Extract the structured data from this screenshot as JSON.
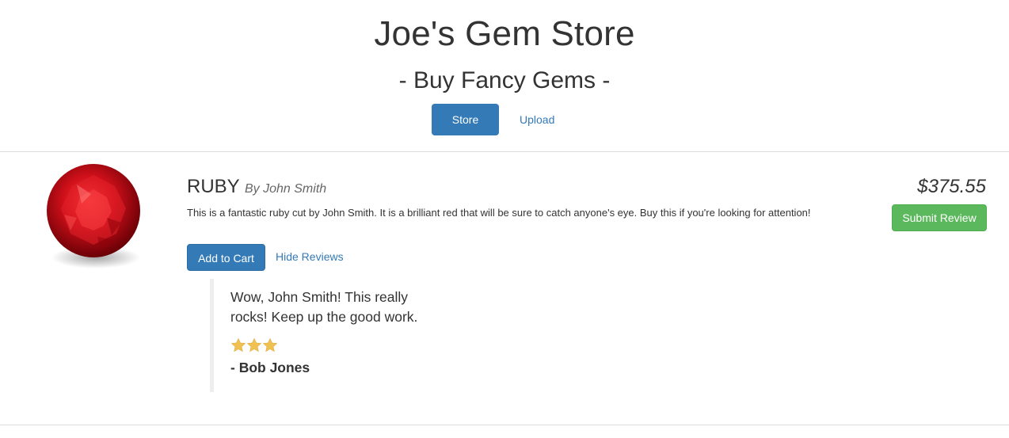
{
  "store": {
    "title": "Joe's Gem Store",
    "subtitle": "- Buy Fancy Gems -"
  },
  "nav": {
    "store_label": "Store",
    "upload_label": "Upload"
  },
  "product": {
    "name": "RUBY",
    "author": "By John Smith",
    "description": "This is a fantastic ruby cut by John Smith. It is a brilliant red that will be sure to catch anyone's eye. Buy this if you're looking for attention!",
    "price": "$375.55",
    "add_to_cart_label": "Add to Cart",
    "hide_reviews_label": "Hide Reviews",
    "submit_review_label": "Submit Review",
    "gem_color": "#d0101a"
  },
  "review": {
    "body": "Wow, John Smith! This really rocks! Keep up the good work.",
    "rating": 3,
    "author": "- Bob Jones",
    "star_color": "#f0c050"
  },
  "colors": {
    "primary": "#337ab7",
    "success": "#5cb85c"
  }
}
